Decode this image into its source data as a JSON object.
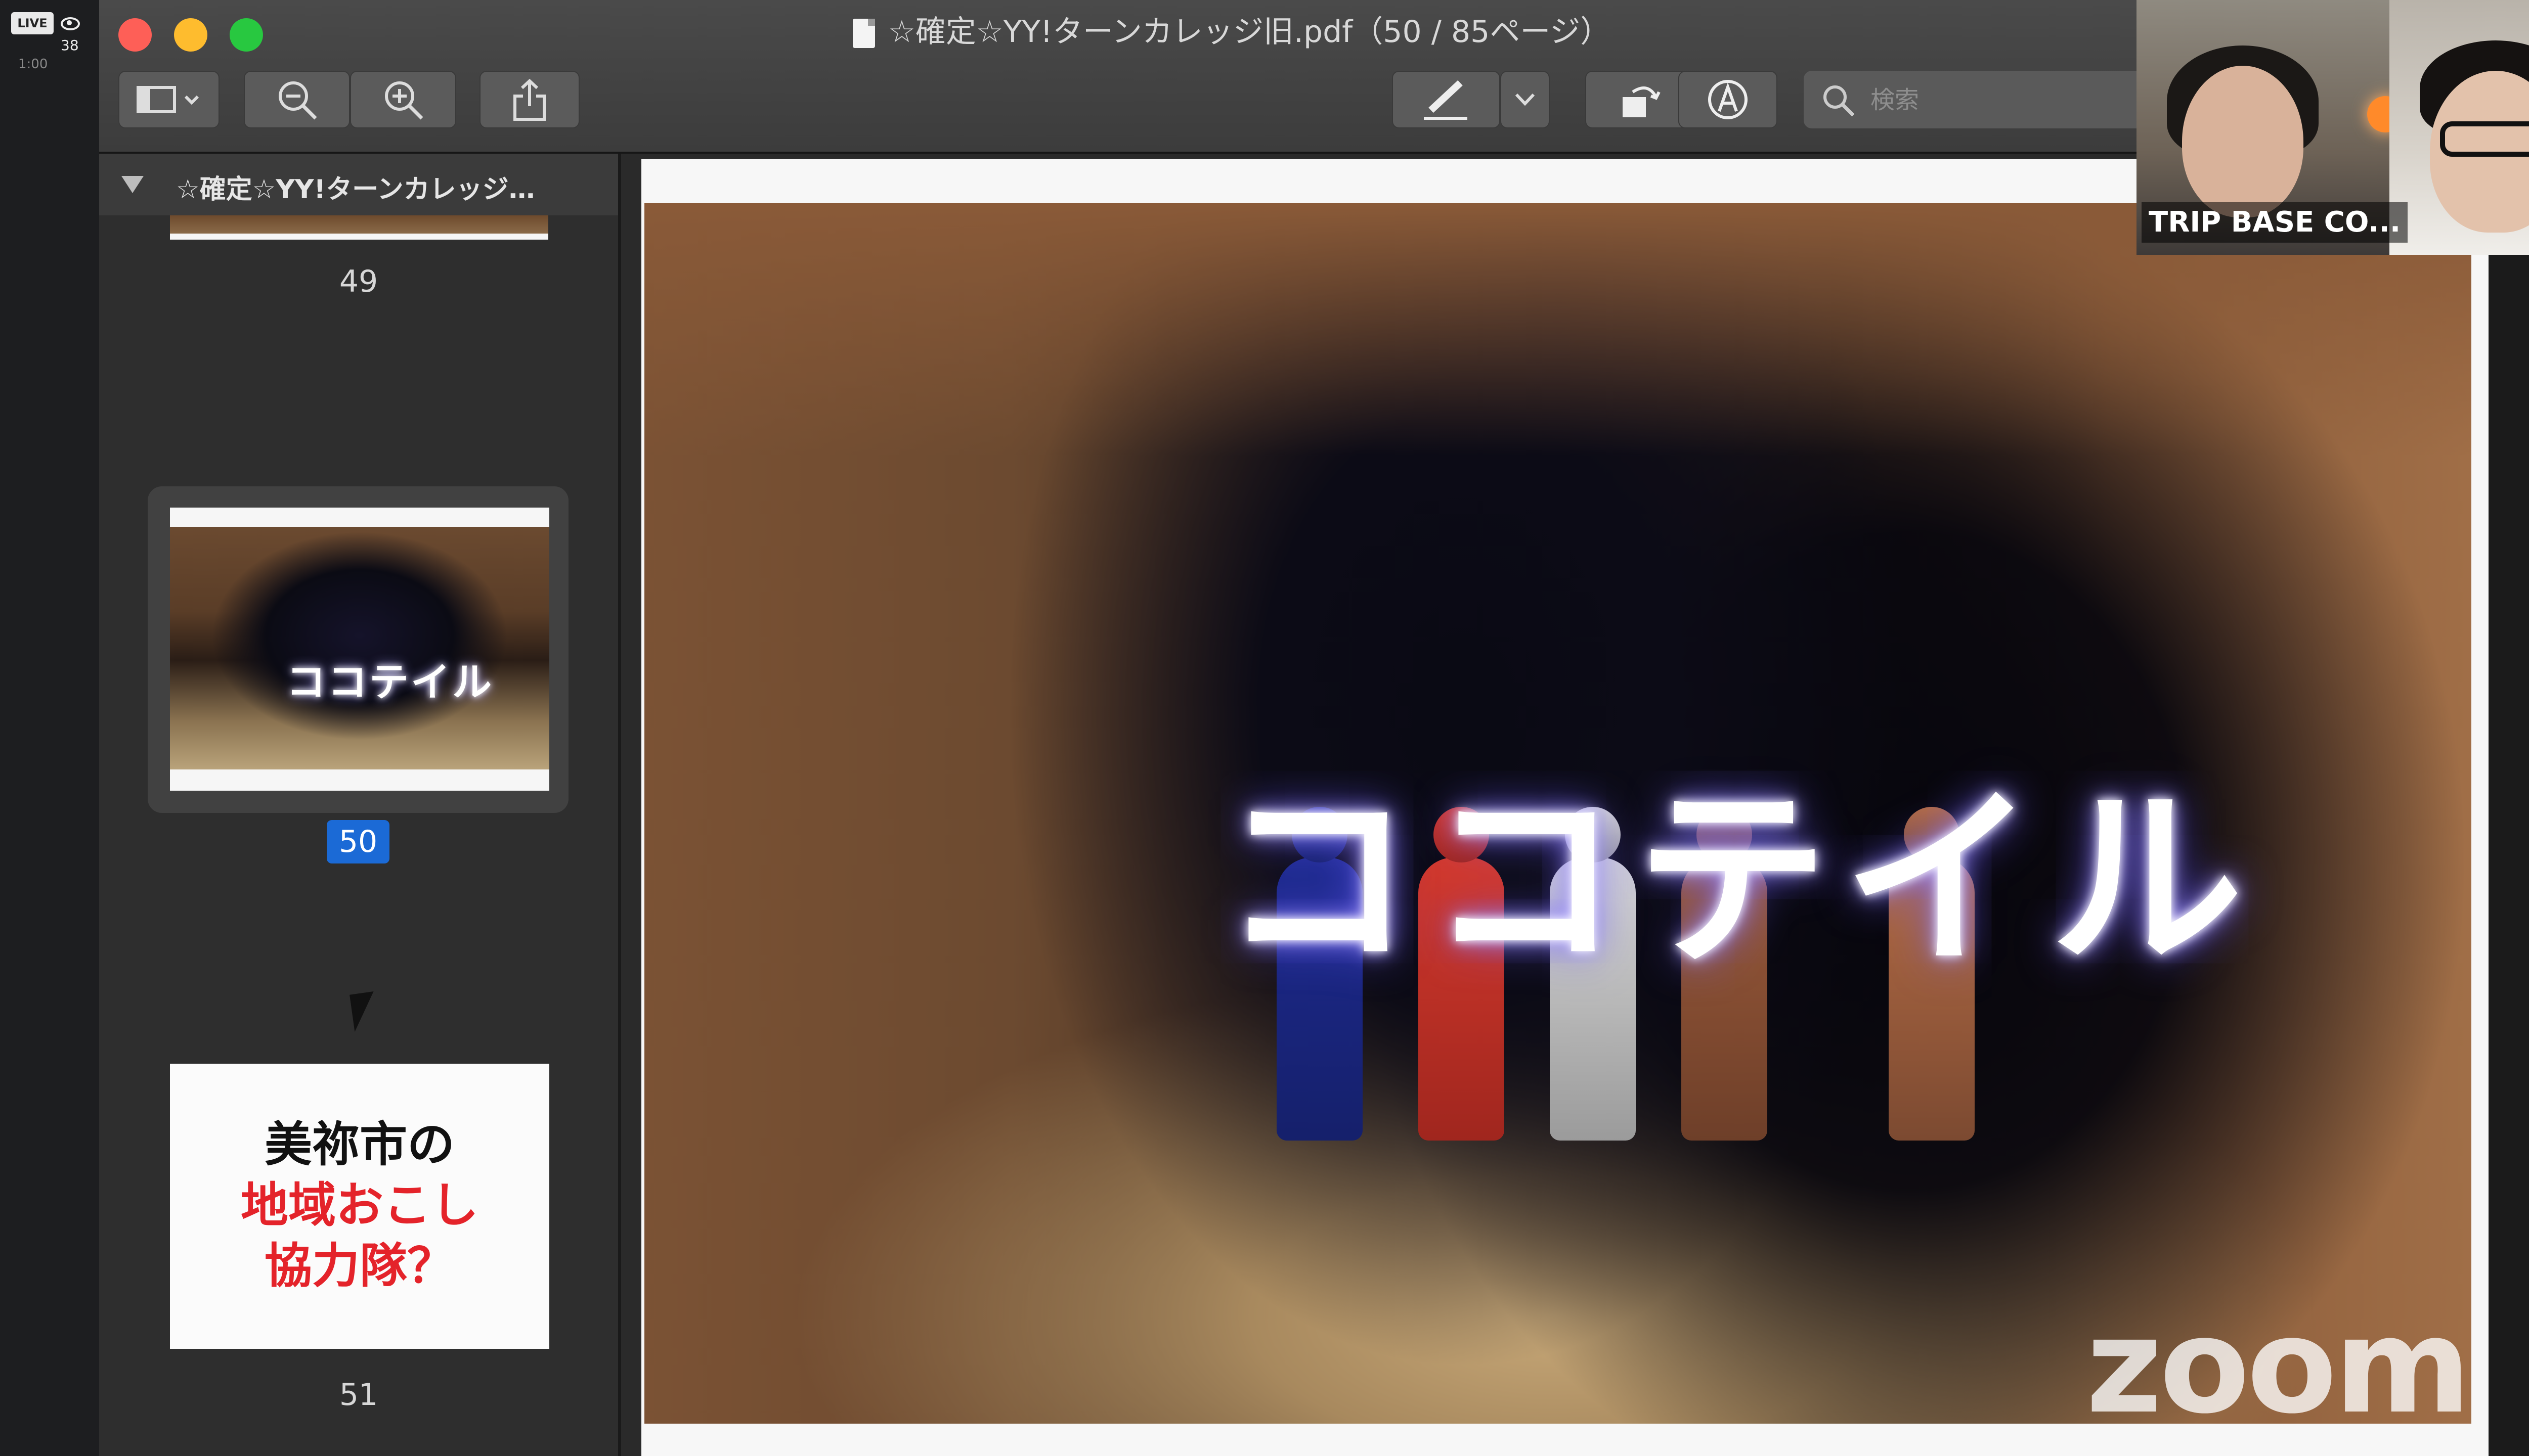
{
  "live": {
    "badge": "LIVE",
    "viewers": "38",
    "timer": "1:00"
  },
  "window": {
    "title": "☆確定☆YY!ターンカレッジ旧.pdf（50 / 85ページ）",
    "search_placeholder": "検索"
  },
  "sidebar": {
    "title": "☆確定☆YY!ターンカレッジ…",
    "pages": [
      {
        "num": "49"
      },
      {
        "num": "50",
        "thumb_text": "ココテイル"
      },
      {
        "num": "51",
        "lines": [
          "美祢市の",
          "地域おこし",
          "協力隊？"
        ]
      }
    ]
  },
  "slide": {
    "light_text": "ココテイル"
  },
  "video": {
    "label": "TRIP BASE CO...",
    "watermark": "zoom"
  },
  "colors": {
    "accent_blue": "#1b6ad6",
    "close": "#fe5f57",
    "minimize": "#febc2e",
    "maximize": "#28c840",
    "slide_red": "#e4232a"
  }
}
